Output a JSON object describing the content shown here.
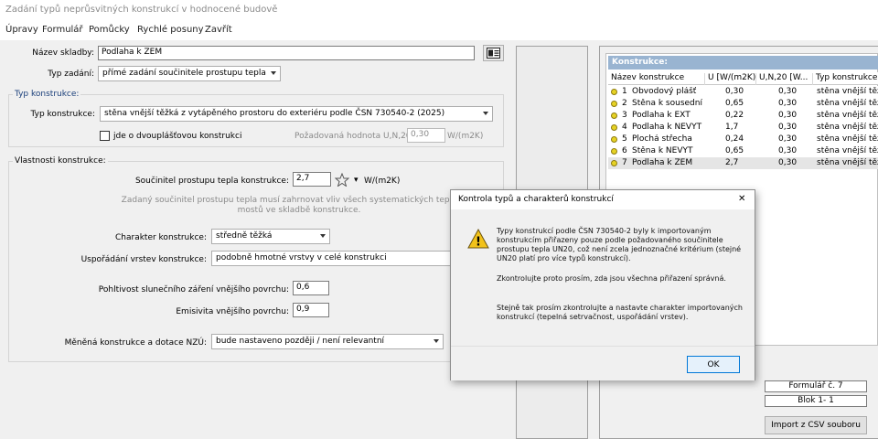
{
  "window": {
    "title": "Zadání typů neprůsvitných konstrukcí v hodnocené budově"
  },
  "menu": [
    "Úpravy",
    "Formulář",
    "Pomůcky",
    "Rychlé posuny",
    "Zavřít"
  ],
  "form": {
    "nazev_label": "Název skladby:",
    "nazev_value": "Podlaha k ZEM",
    "typ_zadani_label": "Typ zadání:",
    "typ_zadani_value": "přímé zadání součinitele prostupu tepla",
    "typ_konstrukce_group": "Typ konstrukce:",
    "typ_konstrukce_label": "Typ konstrukce:",
    "typ_konstrukce_value": "stěna vnější těžká z vytápěného prostoru do exteriéru podle ČSN 730540-2 (2025)",
    "dvouplast_label": "jde o dvouplášťovou konstrukci",
    "pozadovana_label": "Požadovaná hodnota U,N,20:",
    "pozadovana_value": "0,30",
    "pozadovana_unit": "W/(m2K)",
    "vlastnosti_group": "Vlastnosti konstrukce:",
    "soucinitel_label": "Součinitel prostupu tepla konstrukce:",
    "soucinitel_value": "2,7",
    "soucinitel_unit": "W/(m2K)",
    "hint_line1": "Zadaný součinitel prostupu tepla musí zahrnovat vliv všech systematických tepelných",
    "hint_line2": "mostů ve skladbě konstrukce.",
    "charakter_label": "Charakter konstrukce:",
    "charakter_value": "středně těžká",
    "usporadani_label": "Uspořádání vrstev konstrukce:",
    "usporadani_value": "podobně hmotné vrstvy v celé konstrukci",
    "pohltivost_label": "Pohltivost slunečního záření vnějšího povrchu:",
    "pohltivost_value": "0,6",
    "emisivita_label": "Emisivita vnějšího povrchu:",
    "emisivita_value": "0,9",
    "menena_label": "Měněná konstrukce a dotace NZÚ:",
    "menena_value": "bude nastaveno později / není relevantní"
  },
  "table": {
    "title": "Konstrukce:",
    "headers": [
      "Název konstrukce",
      "U [W/(m2K)]",
      "U,N,20 [W...",
      "Typ konstrukce"
    ],
    "rows": [
      {
        "num": "1",
        "name": "Obvodový plášť",
        "u": "0,30",
        "un": "0,30",
        "type": "stěna vnější těž"
      },
      {
        "num": "2",
        "name": "Stěna k sousední ...",
        "u": "0,65",
        "un": "0,30",
        "type": "stěna vnější těž"
      },
      {
        "num": "3",
        "name": "Podlaha k EXT",
        "u": "0,22",
        "un": "0,30",
        "type": "stěna vnější těž"
      },
      {
        "num": "4",
        "name": "Podlaha k NEVYT",
        "u": "1,7",
        "un": "0,30",
        "type": "stěna vnější těž"
      },
      {
        "num": "5",
        "name": "Plochá střecha",
        "u": "0,24",
        "un": "0,30",
        "type": "stěna vnější těž"
      },
      {
        "num": "6",
        "name": "Stěna k NEVYT",
        "u": "0,65",
        "un": "0,30",
        "type": "stěna vnější těž"
      },
      {
        "num": "7",
        "name": "Podlaha k ZEM",
        "u": "2,7",
        "un": "0,30",
        "type": "stěna vnější těž"
      }
    ]
  },
  "side": {
    "formular": "Formulář č.  7",
    "blok": "Blok  1-  1",
    "import_button": "Import z CSV souboru"
  },
  "dialog": {
    "title": "Kontrola typů a charakterů konstrukcí",
    "para1": "Typy konstrukcí podle ČSN 730540-2 byly k importovaným konstrukcím přiřazeny pouze podle požadovaného součinitele prostupu tepla UN20, což není zcela jednoznačné kritérium (stejné UN20 platí pro více typů konstrukcí).",
    "para2": "Zkontrolujte proto prosím, zda jsou všechna přiřazení správná.",
    "para3": "Stejně tak prosím zkontrolujte a nastavte charakter importovaných konstrukcí (tepelná setrvačnost, uspořádání vrstev).",
    "ok": "OK",
    "close": "✕",
    "warning_glyph": "!"
  }
}
